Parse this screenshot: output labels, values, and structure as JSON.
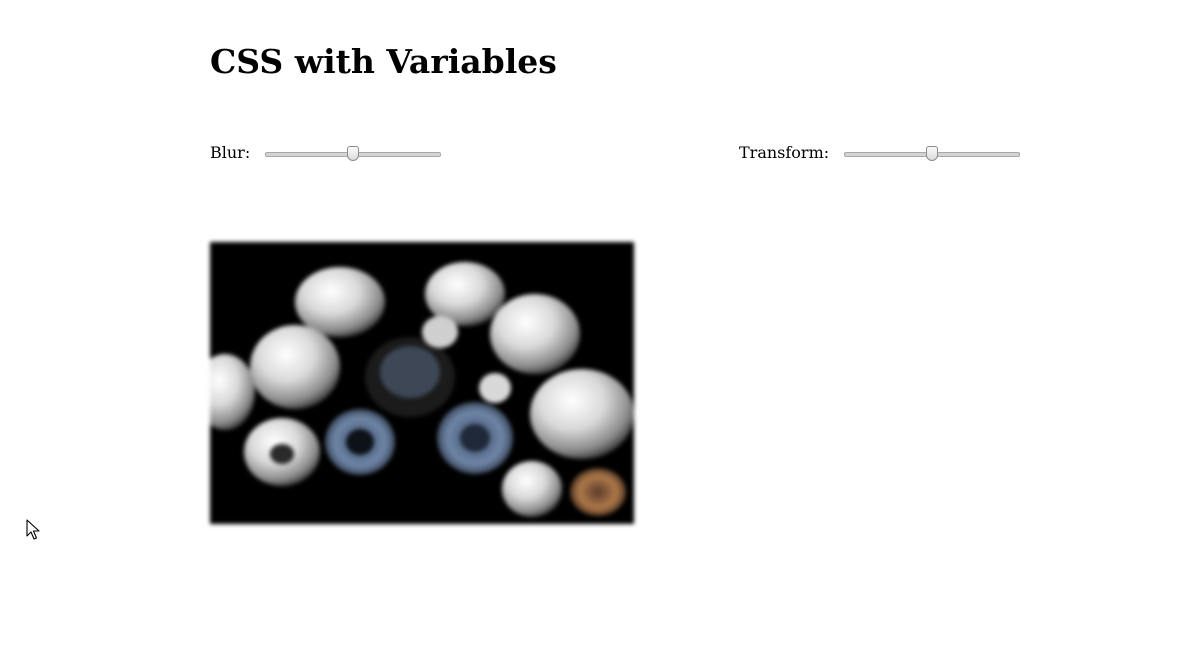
{
  "page": {
    "title": "CSS with Variables"
  },
  "controls": {
    "blur": {
      "label": "Blur:",
      "value_fraction": 0.5
    },
    "transform": {
      "label": "Transform:",
      "value_fraction": 0.5
    }
  },
  "image": {
    "description_icon": "photo-icon",
    "background": "#000000"
  },
  "cursor": {
    "icon": "mouse-pointer-icon"
  }
}
